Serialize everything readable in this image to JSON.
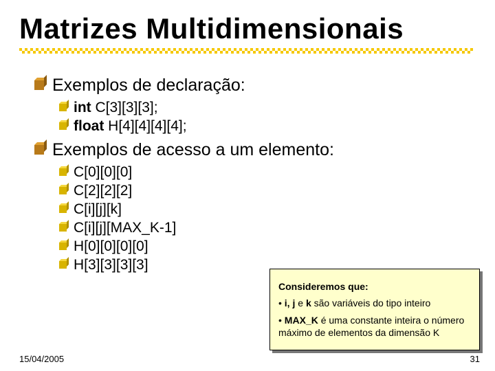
{
  "title": "Matrizes Multidimensionais",
  "sections": {
    "decl": {
      "heading": "Exemplos de declaração:",
      "items": [
        {
          "prefix": "int ",
          "rest": "C[3][3][3];"
        },
        {
          "prefix": "float ",
          "rest": "H[4][4][4][4];"
        }
      ]
    },
    "access": {
      "heading": "Exemplos de acesso a um elemento:",
      "items": [
        "C[0][0][0]",
        "C[2][2][2]",
        "C[i][j][k]",
        "C[i][j][MAX_K-1]",
        "H[0][0][0][0]",
        "H[3][3][3][3]"
      ]
    }
  },
  "callout": {
    "title": "Consideremos que:",
    "line1_prefix": "• ",
    "line1_bold": "i, j",
    "line1_mid": " e ",
    "line1_bold2": "k",
    "line1_rest": " são variáveis do tipo inteiro",
    "line2_prefix": "• ",
    "line2_bold": "MAX_K",
    "line2_rest": " é uma constante inteira o número máximo de elementos da dimensão K"
  },
  "footer": {
    "date": "15/04/2005",
    "page": "31"
  }
}
